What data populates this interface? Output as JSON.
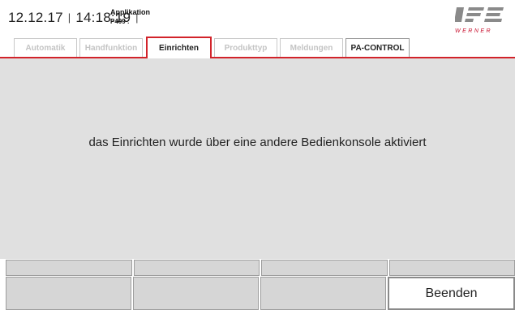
{
  "header": {
    "date": "12.12.17",
    "time": "14:18:19",
    "app_label": "Applikation",
    "app_code": "P409 :",
    "logo_text": "WERNER"
  },
  "tabs": [
    {
      "label": "Automatik",
      "state": "disabled"
    },
    {
      "label": "Handfunktion",
      "state": "disabled"
    },
    {
      "label": "Einrichten",
      "state": "active"
    },
    {
      "label": "Produkttyp",
      "state": "disabled"
    },
    {
      "label": "Meldungen",
      "state": "disabled"
    },
    {
      "label": "PA-CONTROL",
      "state": "enabled"
    }
  ],
  "message": "das Einrichten wurde über eine andere Bedienkonsole aktiviert",
  "buttons": {
    "beenden_label": "Beenden"
  },
  "colors": {
    "accent_red": "#d2232a",
    "content_bg": "#e0e0e0"
  }
}
